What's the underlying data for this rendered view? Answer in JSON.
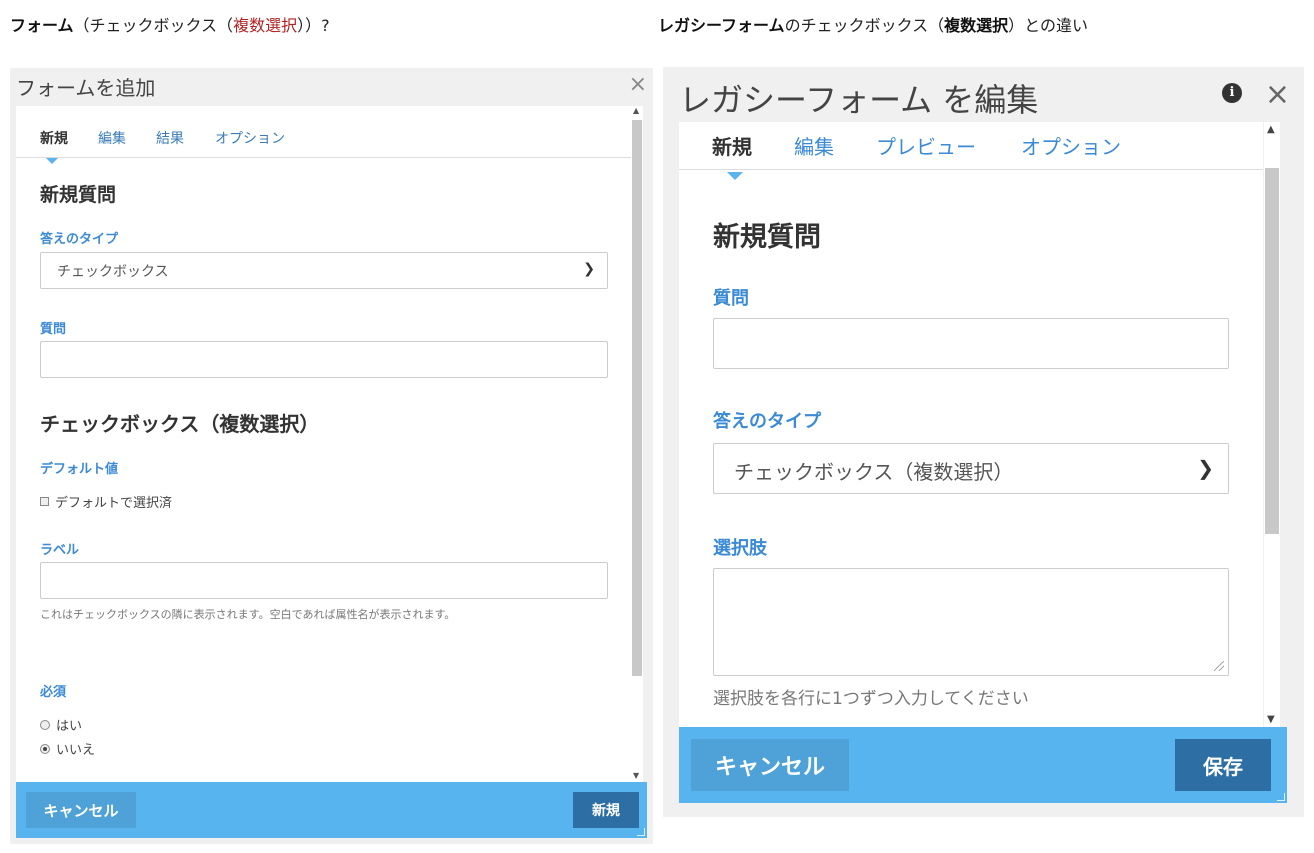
{
  "captions": {
    "left": {
      "bold": "フォーム",
      "open": "（チェックボックス（",
      "red": "複数選択",
      "close": "））?"
    },
    "right": {
      "bold": "レガシーフォーム",
      "mid": "のチェックボックス（",
      "bold2": "複数選択",
      "end": "）との違い"
    }
  },
  "left_dialog": {
    "title": "フォームを追加",
    "close": "×",
    "tabs": [
      "新規",
      "編集",
      "結果",
      "オプション"
    ],
    "heading": "新規質問",
    "answer_type_label": "答えのタイプ",
    "answer_type_value": "チェックボックス",
    "question_label": "質問",
    "question_value": "",
    "section_heading": "チェックボックス（複数選択）",
    "default_label": "デフォルト値",
    "default_checkbox_text": "デフォルトで選択済",
    "label_label": "ラベル",
    "label_value": "",
    "label_help": "これはチェックボックスの隣に表示されます。空白であれば属性名が表示されます。",
    "required_label": "必須",
    "required_options": [
      "はい",
      "いいえ"
    ],
    "required_selected": "いいえ",
    "cancel_button": "キャンセル",
    "submit_button": "新規"
  },
  "right_dialog": {
    "title": "レガシーフォーム を編集",
    "info": "i",
    "close": "×",
    "tabs": [
      "新規",
      "編集",
      "プレビュー",
      "オプション"
    ],
    "heading": "新規質問",
    "question_label": "質問",
    "question_value": "",
    "answer_type_label": "答えのタイプ",
    "answer_type_value": "チェックボックス（複数選択）",
    "choices_label": "選択肢",
    "choices_value": "",
    "choices_help": "選択肢を各行に1つずつ入力してください",
    "cancel_button": "キャンセル",
    "save_button": "保存"
  },
  "icons": {
    "dropdown": "chevron-down-icon",
    "close": "close-icon",
    "info": "info-icon"
  },
  "colors": {
    "accent_blue": "#57b4ef",
    "primary_button": "#2d6fa5",
    "label_blue": "#3a8ad6",
    "highlight_red": "#b22222"
  }
}
